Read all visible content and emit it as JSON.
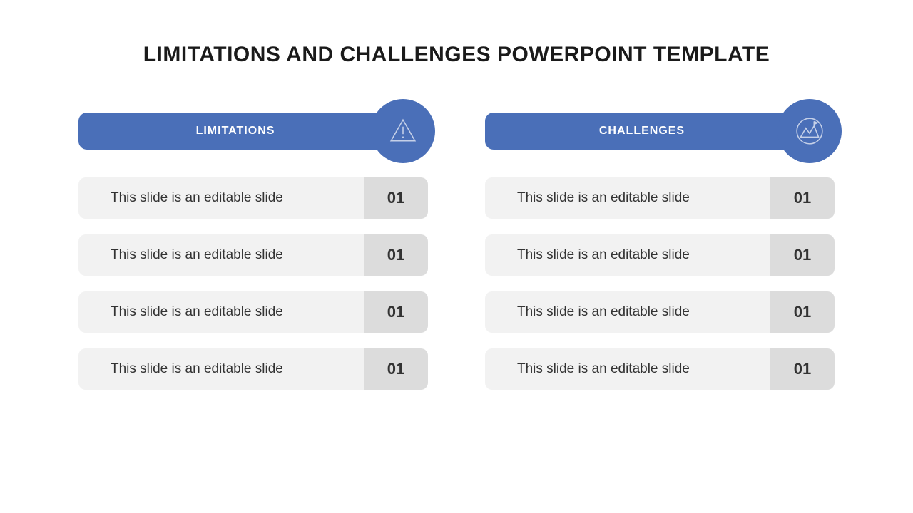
{
  "title": "LIMITATIONS AND CHALLENGES POWERPOINT TEMPLATE",
  "colors": {
    "accent": "#4a6fb8",
    "row_bg": "#f2f2f2",
    "num_bg": "#dcdcdc"
  },
  "columns": [
    {
      "label": "LIMITATIONS",
      "icon": "warning-icon",
      "items": [
        {
          "text": "This slide is an editable slide",
          "num": "01"
        },
        {
          "text": "This slide is an editable slide",
          "num": "01"
        },
        {
          "text": "This slide is an editable slide",
          "num": "01"
        },
        {
          "text": "This slide is an editable slide",
          "num": "01"
        }
      ]
    },
    {
      "label": "CHALLENGES",
      "icon": "mountain-icon",
      "items": [
        {
          "text": "This slide is an editable slide",
          "num": "01"
        },
        {
          "text": "This slide is an editable slide",
          "num": "01"
        },
        {
          "text": "This slide is an editable slide",
          "num": "01"
        },
        {
          "text": "This slide is an editable slide",
          "num": "01"
        }
      ]
    }
  ]
}
